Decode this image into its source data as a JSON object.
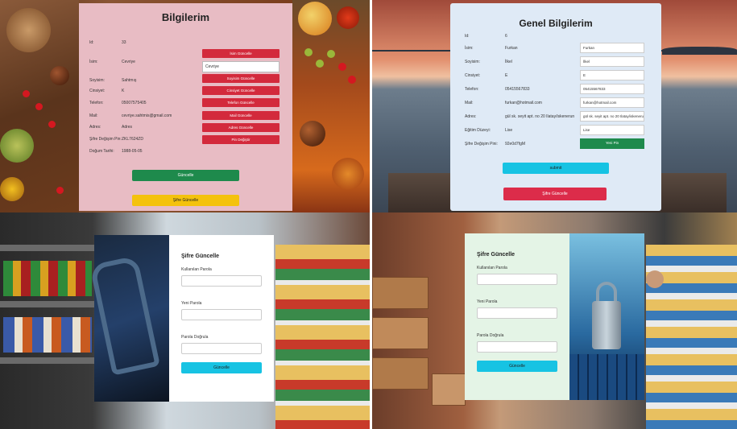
{
  "profile": {
    "title": "Bilgilerim",
    "fields": [
      {
        "label": "Id:",
        "value": "33"
      },
      {
        "label": "İsim:",
        "value": "Cevriye"
      },
      {
        "label": "Soyisim:",
        "value": "Sahtmış"
      },
      {
        "label": "Cinsiyet:",
        "value": "K"
      },
      {
        "label": "Telefon:",
        "value": "05007575405"
      },
      {
        "label": "Mail:",
        "value": "cevriye.sahtmis@gmail.com"
      },
      {
        "label": "Adres:",
        "value": "Adres"
      },
      {
        "label": "Şifre Değişim Pin:",
        "value": "ZKL7624ZD"
      },
      {
        "label": "Doğum Tarihi:",
        "value": "1988-05-05"
      }
    ],
    "name_input": "Cevriye",
    "buttons": [
      "İsim Güncelle",
      "Soyisim Güncelle",
      "Cinsiyet Güncelle",
      "Telefon Güncelle",
      "Mail Güncelle",
      "Adres Güncelle",
      "Pin Değiştir"
    ],
    "update_label": "Güncelle",
    "password_update_label": "Şifre Güncelle"
  },
  "general": {
    "title": "Genel Bilgilerim",
    "fields": [
      {
        "label": "Id:",
        "value": "6",
        "input": ""
      },
      {
        "label": "İsim:",
        "value": "Furkan",
        "input": "Furkan"
      },
      {
        "label": "Soyisim:",
        "value": "İlkel",
        "input": "İlkel"
      },
      {
        "label": "Cinsiyet:",
        "value": "E",
        "input": "E"
      },
      {
        "label": "Telefon:",
        "value": "05415567833",
        "input": "05415567833"
      },
      {
        "label": "Mail:",
        "value": "furkan@hotmail.com",
        "input": "furkan@hotmail.com"
      },
      {
        "label": "Adres:",
        "value": "gül sk. seyit apt. no 20 Ilatay/iskenerun",
        "input": "gül sk. seyit apt. no 20 Ilatay/iskenerun"
      },
      {
        "label": "Eğitim Düzeyi:",
        "value": "Lise",
        "input": "Lise"
      },
      {
        "label": "Şifre Değişim Pini:",
        "value": "92e0d7fgM",
        "input": ""
      }
    ],
    "new_pin_label": "Yeni Pin",
    "submit_label": "submit",
    "password_update_label": "Şifre Güncelle"
  },
  "pw_form_a": {
    "title": "Şifre Güncelle",
    "current_label": "Kullanılan Parola",
    "new_label": "Yeni Parola",
    "confirm_label": "Parola Doğrula",
    "button_label": "Güncelle"
  },
  "pw_form_b": {
    "title": "Şifre Güncelle",
    "current_label": "Kullanılan Parola",
    "new_label": "Yeni Parola",
    "confirm_label": "Parola Doğrula",
    "button_label": "Güncelle"
  },
  "colors": {
    "red": "#d32a3c",
    "green": "#1e8a4c",
    "yellow": "#f4c20d",
    "cyan": "#17c3e3",
    "pink_card": "#e8bcc4",
    "blue_card": "#dfeaf6",
    "mint_card": "#e4f4e6"
  }
}
